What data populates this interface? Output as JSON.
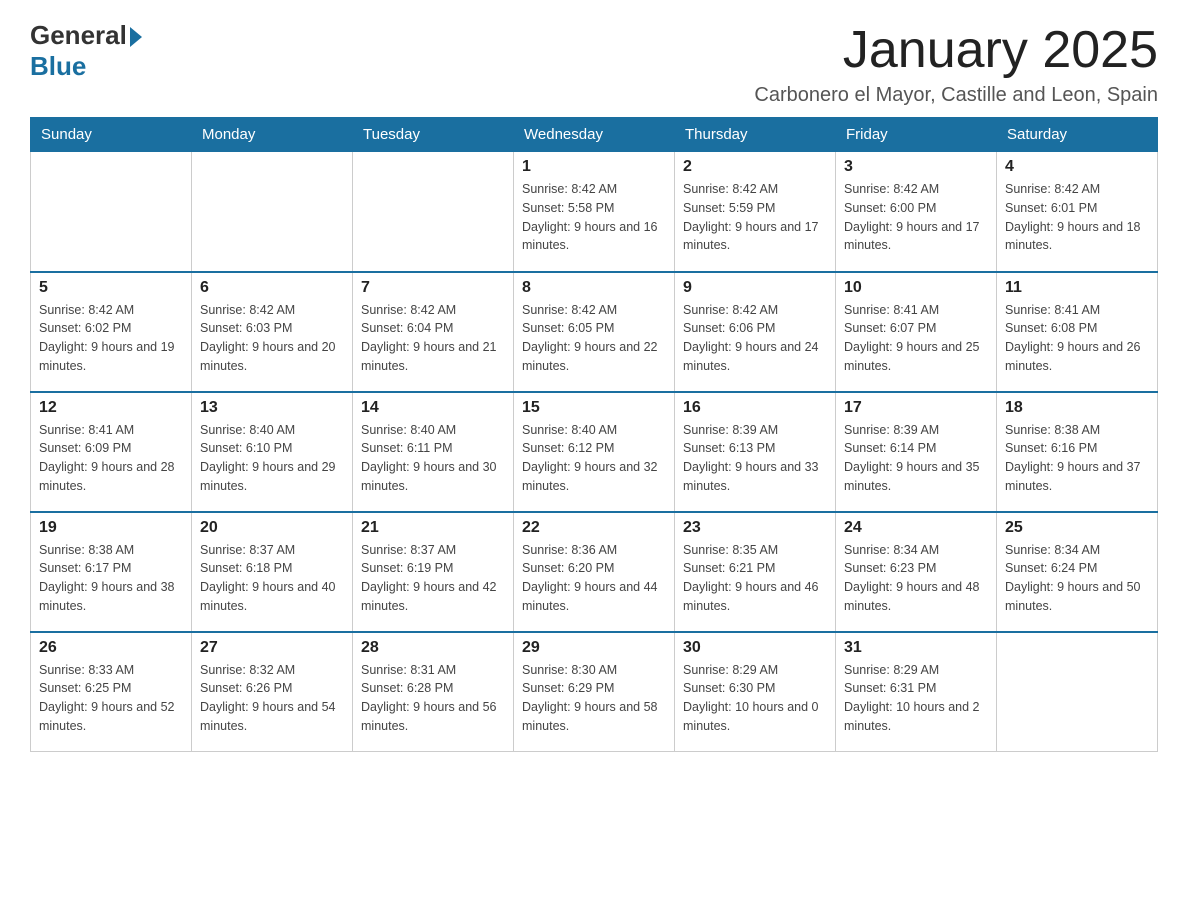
{
  "header": {
    "logo_general": "General",
    "logo_blue": "Blue",
    "month_title": "January 2025",
    "location": "Carbonero el Mayor, Castille and Leon, Spain"
  },
  "days_of_week": [
    "Sunday",
    "Monday",
    "Tuesday",
    "Wednesday",
    "Thursday",
    "Friday",
    "Saturday"
  ],
  "weeks": [
    [
      {
        "day": "",
        "sunrise": "",
        "sunset": "",
        "daylight": ""
      },
      {
        "day": "",
        "sunrise": "",
        "sunset": "",
        "daylight": ""
      },
      {
        "day": "",
        "sunrise": "",
        "sunset": "",
        "daylight": ""
      },
      {
        "day": "1",
        "sunrise": "Sunrise: 8:42 AM",
        "sunset": "Sunset: 5:58 PM",
        "daylight": "Daylight: 9 hours and 16 minutes."
      },
      {
        "day": "2",
        "sunrise": "Sunrise: 8:42 AM",
        "sunset": "Sunset: 5:59 PM",
        "daylight": "Daylight: 9 hours and 17 minutes."
      },
      {
        "day": "3",
        "sunrise": "Sunrise: 8:42 AM",
        "sunset": "Sunset: 6:00 PM",
        "daylight": "Daylight: 9 hours and 17 minutes."
      },
      {
        "day": "4",
        "sunrise": "Sunrise: 8:42 AM",
        "sunset": "Sunset: 6:01 PM",
        "daylight": "Daylight: 9 hours and 18 minutes."
      }
    ],
    [
      {
        "day": "5",
        "sunrise": "Sunrise: 8:42 AM",
        "sunset": "Sunset: 6:02 PM",
        "daylight": "Daylight: 9 hours and 19 minutes."
      },
      {
        "day": "6",
        "sunrise": "Sunrise: 8:42 AM",
        "sunset": "Sunset: 6:03 PM",
        "daylight": "Daylight: 9 hours and 20 minutes."
      },
      {
        "day": "7",
        "sunrise": "Sunrise: 8:42 AM",
        "sunset": "Sunset: 6:04 PM",
        "daylight": "Daylight: 9 hours and 21 minutes."
      },
      {
        "day": "8",
        "sunrise": "Sunrise: 8:42 AM",
        "sunset": "Sunset: 6:05 PM",
        "daylight": "Daylight: 9 hours and 22 minutes."
      },
      {
        "day": "9",
        "sunrise": "Sunrise: 8:42 AM",
        "sunset": "Sunset: 6:06 PM",
        "daylight": "Daylight: 9 hours and 24 minutes."
      },
      {
        "day": "10",
        "sunrise": "Sunrise: 8:41 AM",
        "sunset": "Sunset: 6:07 PM",
        "daylight": "Daylight: 9 hours and 25 minutes."
      },
      {
        "day": "11",
        "sunrise": "Sunrise: 8:41 AM",
        "sunset": "Sunset: 6:08 PM",
        "daylight": "Daylight: 9 hours and 26 minutes."
      }
    ],
    [
      {
        "day": "12",
        "sunrise": "Sunrise: 8:41 AM",
        "sunset": "Sunset: 6:09 PM",
        "daylight": "Daylight: 9 hours and 28 minutes."
      },
      {
        "day": "13",
        "sunrise": "Sunrise: 8:40 AM",
        "sunset": "Sunset: 6:10 PM",
        "daylight": "Daylight: 9 hours and 29 minutes."
      },
      {
        "day": "14",
        "sunrise": "Sunrise: 8:40 AM",
        "sunset": "Sunset: 6:11 PM",
        "daylight": "Daylight: 9 hours and 30 minutes."
      },
      {
        "day": "15",
        "sunrise": "Sunrise: 8:40 AM",
        "sunset": "Sunset: 6:12 PM",
        "daylight": "Daylight: 9 hours and 32 minutes."
      },
      {
        "day": "16",
        "sunrise": "Sunrise: 8:39 AM",
        "sunset": "Sunset: 6:13 PM",
        "daylight": "Daylight: 9 hours and 33 minutes."
      },
      {
        "day": "17",
        "sunrise": "Sunrise: 8:39 AM",
        "sunset": "Sunset: 6:14 PM",
        "daylight": "Daylight: 9 hours and 35 minutes."
      },
      {
        "day": "18",
        "sunrise": "Sunrise: 8:38 AM",
        "sunset": "Sunset: 6:16 PM",
        "daylight": "Daylight: 9 hours and 37 minutes."
      }
    ],
    [
      {
        "day": "19",
        "sunrise": "Sunrise: 8:38 AM",
        "sunset": "Sunset: 6:17 PM",
        "daylight": "Daylight: 9 hours and 38 minutes."
      },
      {
        "day": "20",
        "sunrise": "Sunrise: 8:37 AM",
        "sunset": "Sunset: 6:18 PM",
        "daylight": "Daylight: 9 hours and 40 minutes."
      },
      {
        "day": "21",
        "sunrise": "Sunrise: 8:37 AM",
        "sunset": "Sunset: 6:19 PM",
        "daylight": "Daylight: 9 hours and 42 minutes."
      },
      {
        "day": "22",
        "sunrise": "Sunrise: 8:36 AM",
        "sunset": "Sunset: 6:20 PM",
        "daylight": "Daylight: 9 hours and 44 minutes."
      },
      {
        "day": "23",
        "sunrise": "Sunrise: 8:35 AM",
        "sunset": "Sunset: 6:21 PM",
        "daylight": "Daylight: 9 hours and 46 minutes."
      },
      {
        "day": "24",
        "sunrise": "Sunrise: 8:34 AM",
        "sunset": "Sunset: 6:23 PM",
        "daylight": "Daylight: 9 hours and 48 minutes."
      },
      {
        "day": "25",
        "sunrise": "Sunrise: 8:34 AM",
        "sunset": "Sunset: 6:24 PM",
        "daylight": "Daylight: 9 hours and 50 minutes."
      }
    ],
    [
      {
        "day": "26",
        "sunrise": "Sunrise: 8:33 AM",
        "sunset": "Sunset: 6:25 PM",
        "daylight": "Daylight: 9 hours and 52 minutes."
      },
      {
        "day": "27",
        "sunrise": "Sunrise: 8:32 AM",
        "sunset": "Sunset: 6:26 PM",
        "daylight": "Daylight: 9 hours and 54 minutes."
      },
      {
        "day": "28",
        "sunrise": "Sunrise: 8:31 AM",
        "sunset": "Sunset: 6:28 PM",
        "daylight": "Daylight: 9 hours and 56 minutes."
      },
      {
        "day": "29",
        "sunrise": "Sunrise: 8:30 AM",
        "sunset": "Sunset: 6:29 PM",
        "daylight": "Daylight: 9 hours and 58 minutes."
      },
      {
        "day": "30",
        "sunrise": "Sunrise: 8:29 AM",
        "sunset": "Sunset: 6:30 PM",
        "daylight": "Daylight: 10 hours and 0 minutes."
      },
      {
        "day": "31",
        "sunrise": "Sunrise: 8:29 AM",
        "sunset": "Sunset: 6:31 PM",
        "daylight": "Daylight: 10 hours and 2 minutes."
      },
      {
        "day": "",
        "sunrise": "",
        "sunset": "",
        "daylight": ""
      }
    ]
  ]
}
